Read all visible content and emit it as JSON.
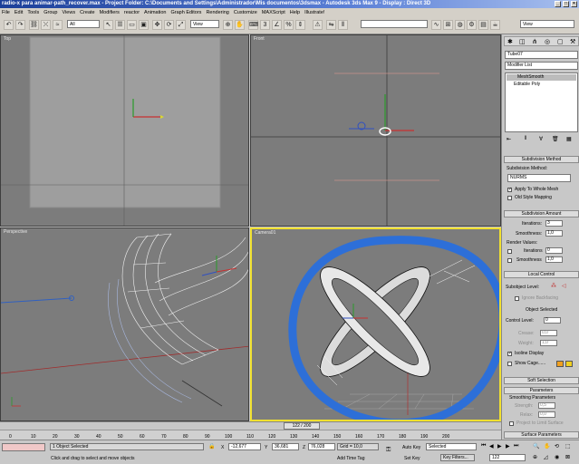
{
  "window": {
    "title": "radio-x para animar-path_recover.max   - Project Folder: C:\\Documents and Settings\\Administrador\\Mis documentos\\3dsmax   - Autodesk 3ds Max 9   - Display : Direct 3D"
  },
  "menu": [
    "File",
    "Edit",
    "Tools",
    "Group",
    "Views",
    "Create",
    "Modifiers",
    "reactor",
    "Animation",
    "Graph Editors",
    "Rendering",
    "Customize",
    "MAXScript",
    "Help",
    "Illustrate!"
  ],
  "toolbar": {
    "selection_filter": "All",
    "ref_coord": "View",
    "named_selection": "",
    "right_combo": "View"
  },
  "viewports": {
    "top": "Top",
    "front": "Front",
    "perspective": "Perspective",
    "camera": "Camera01"
  },
  "command_panel": {
    "object_name": "Tube07",
    "modifier_list": "Modifier List",
    "stack": [
      "MeshSmooth",
      "Editable Poly"
    ],
    "subdivision_method": {
      "title": "Subdivision Method",
      "label": "Subdivision Method:",
      "value": "NURMS",
      "apply_whole_mesh": "Apply To Whole Mesh",
      "old_style": "Old Style Mapping"
    },
    "subdivision_amount": {
      "title": "Subdivision Amount",
      "iterations_label": "Iterations:",
      "iterations": "3",
      "smoothness_label": "Smoothness:",
      "smoothness": "1,0",
      "render_values": "Render Values:",
      "r_iterations": "Iterations",
      "r_iterations_value": "0",
      "r_smoothness": "Smoothness",
      "r_smoothness_value": "1,0"
    },
    "local_control": {
      "title": "Local Control",
      "subobject": "Subobject Level:",
      "ignore_backfacing": "Ignore Backfacing",
      "object_selected": "Object Selected",
      "control_level": "Control Level:",
      "control_level_value": "0",
      "crease": "Crease:",
      "crease_value": "0,0",
      "weight": "Weight:",
      "weight_value": "1,0",
      "isoline": "Isoline Display",
      "show_cage": "Show Cage......"
    },
    "soft_selection": "Soft Selection",
    "parameters": {
      "title": "Parameters",
      "smoothing": "Smoothing Parameters",
      "strength": "Strength:",
      "strength_value": "0,5",
      "relax": "Relax:",
      "relax_value": "0,0",
      "project": "Project to Limit Surface"
    },
    "surface_params": "Surface Parameters"
  },
  "timeline": {
    "slider": "122 / 200",
    "ticks": [
      "0",
      "10",
      "20",
      "30",
      "40",
      "50",
      "60",
      "70",
      "80",
      "90",
      "100",
      "110",
      "120",
      "130",
      "140",
      "150",
      "160",
      "170",
      "180",
      "190",
      "200"
    ]
  },
  "status": {
    "selected": "1 Object Selected",
    "prompt": "Click and drag to select and move objects",
    "x": "-12,677",
    "y": "36,681",
    "z": "76,028",
    "grid": "Grid = 10,0",
    "add_time_tag": "Add Time Tag",
    "auto_key": "Auto Key",
    "set_key": "Set Key",
    "key_mode": "Selected",
    "key_filters": "Key Filters...",
    "frame": "122"
  },
  "colors": {
    "accent_blue_stroke": "#2d6fd8",
    "viewport_bg": "#7c7c7c",
    "active_border": "#f0e030"
  }
}
